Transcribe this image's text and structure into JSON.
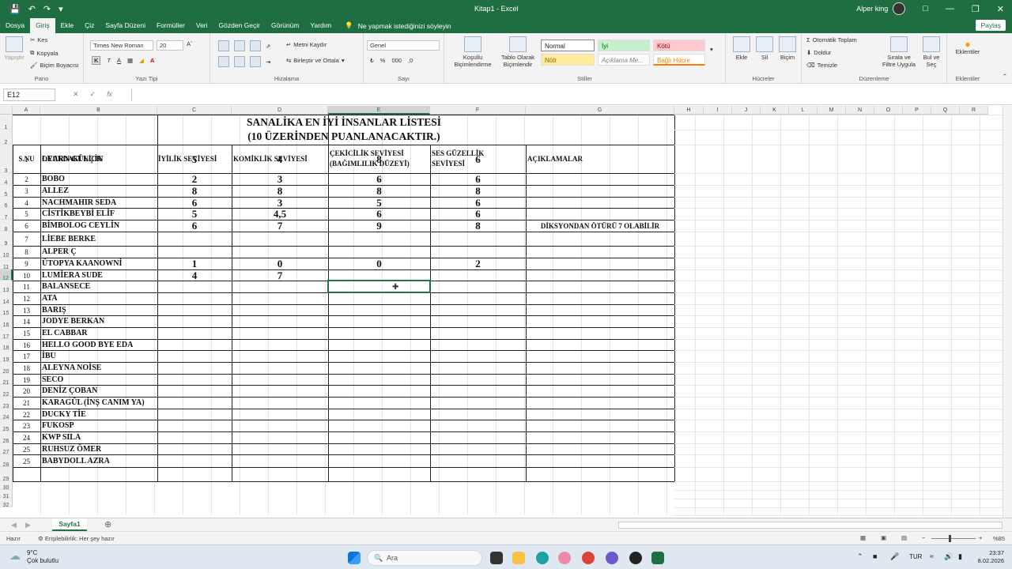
{
  "window": {
    "title": "Kitap1 - Excel",
    "user": "Alper king"
  },
  "tabs": [
    "Dosya",
    "Giriş",
    "Ekle",
    "Çiz",
    "Sayfa Düzeni",
    "Formüller",
    "Veri",
    "Gözden Geçir",
    "Görünüm",
    "Yardım"
  ],
  "active_tab": "Giriş",
  "tell_me": "Ne yapmak istediğinizi söyleyin",
  "share": "Paylaş",
  "ribbon": {
    "clipboard": {
      "paste": "Yapıştır",
      "cut": "Kes",
      "copy": "Kopyala",
      "format_painter": "Biçim Boyacısı",
      "label": "Pano"
    },
    "font": {
      "name": "Times New Roman",
      "size": "20",
      "label": "Yazı Tipi",
      "bold": "K",
      "italic": "T",
      "underline": "A"
    },
    "alignment": {
      "wrap": "Metni Kaydır",
      "merge": "Birleştir ve Ortala",
      "label": "Hizalama"
    },
    "number": {
      "format": "Genel",
      "label": "Sayı"
    },
    "styles": {
      "conditional": "Koşullu Biçimlendirme",
      "table": "Tablo Olarak Biçimlendir",
      "normal": "Normal",
      "good": "İyi",
      "bad": "Kötü",
      "neutral": "Nötr",
      "explanatory": "Açıklama Me...",
      "linked": "Bağlı Hücre",
      "label": "Stiller"
    },
    "cells": {
      "insert": "Ekle",
      "delete": "Sil",
      "format": "Biçim",
      "label": "Hücreler"
    },
    "editing": {
      "autosum": "Otomatik Toplam",
      "fill": "Doldur",
      "clear": "Temizle",
      "sort": "Sırala ve Filtre Uygula",
      "find": "Bul ve Seç",
      "label": "Düzenleme"
    },
    "addins": {
      "label": "Eklentiler",
      "name": "Eklentiler"
    }
  },
  "formula_bar": {
    "name_box": "E12",
    "formula": ""
  },
  "columns": [
    "A",
    "B",
    "C",
    "D",
    "E",
    "F",
    "G",
    "H",
    "I",
    "J",
    "K",
    "L",
    "M",
    "N",
    "O",
    "P",
    "Q",
    "R"
  ],
  "sheet": {
    "title_line1": "SANALİKA EN İYİ İNSANLAR LİSTESİ",
    "title_line2": "(10 ÜZERİNDEN PUANLANACAKTIR.)",
    "headers": [
      "S.NU",
      "OYUNDAKİ NİCK",
      "İYİLİK SEVİYESİ",
      "KOMİKLİK SEVİYESİ",
      "ÇEKİCİLİK SEVİYESİ (BAĞIMLILIK DÜZEYİ)",
      "SES GÜZELLİK SEVİYESİ",
      "AÇIKLAMALAR"
    ],
    "rows": [
      {
        "sn": "1",
        "nick": "LEARN GÜLÇİN",
        "iyilik": "5",
        "komiklik": "4",
        "cekicilik": "8",
        "ses": "6",
        "aciklama": ""
      },
      {
        "sn": "2",
        "nick": "BOBO",
        "iyilik": "2",
        "komiklik": "3",
        "cekicilik": "6",
        "ses": "6",
        "aciklama": ""
      },
      {
        "sn": "3",
        "nick": "ALLEZ",
        "iyilik": "8",
        "komiklik": "8",
        "cekicilik": "8",
        "ses": "8",
        "aciklama": ""
      },
      {
        "sn": "4",
        "nick": "NACHMAHIR SEDA",
        "iyilik": "6",
        "komiklik": "3",
        "cekicilik": "5",
        "ses": "6",
        "aciklama": ""
      },
      {
        "sn": "5",
        "nick": "CİSTİKBEYBİ ELİF",
        "iyilik": "5",
        "komiklik": "4,5",
        "cekicilik": "6",
        "ses": "6",
        "aciklama": ""
      },
      {
        "sn": "6",
        "nick": "BİMBOLOG CEYLİN",
        "iyilik": "6",
        "komiklik": "7",
        "cekicilik": "9",
        "ses": "8",
        "aciklama": "DİKSYONDAN ÖTÜRÜ 7 OLABİLİR"
      },
      {
        "sn": "7",
        "nick": "LİEBE BERKE",
        "iyilik": "",
        "komiklik": "",
        "cekicilik": "",
        "ses": "",
        "aciklama": ""
      },
      {
        "sn": "8",
        "nick": "ALPER Ç",
        "iyilik": "",
        "komiklik": "",
        "cekicilik": "",
        "ses": "",
        "aciklama": ""
      },
      {
        "sn": "9",
        "nick": "ÜTOPYA KAANOWNİ",
        "iyilik": "1",
        "komiklik": "0",
        "cekicilik": "0",
        "ses": "2",
        "aciklama": ""
      },
      {
        "sn": "10",
        "nick": "LUMİERA SUDE",
        "iyilik": "4",
        "komiklik": "7",
        "cekicilik": "",
        "ses": "",
        "aciklama": ""
      },
      {
        "sn": "11",
        "nick": "BALANSECE",
        "iyilik": "",
        "komiklik": "",
        "cekicilik": "",
        "ses": "",
        "aciklama": ""
      },
      {
        "sn": "12",
        "nick": "ATA",
        "iyilik": "",
        "komiklik": "",
        "cekicilik": "",
        "ses": "",
        "aciklama": ""
      },
      {
        "sn": "13",
        "nick": "BARIŞ",
        "iyilik": "",
        "komiklik": "",
        "cekicilik": "",
        "ses": "",
        "aciklama": ""
      },
      {
        "sn": "14",
        "nick": "JODYE BERKAN",
        "iyilik": "",
        "komiklik": "",
        "cekicilik": "",
        "ses": "",
        "aciklama": ""
      },
      {
        "sn": "15",
        "nick": "EL CABBAR",
        "iyilik": "",
        "komiklik": "",
        "cekicilik": "",
        "ses": "",
        "aciklama": ""
      },
      {
        "sn": "16",
        "nick": "HELLO GOOD BYE EDA",
        "iyilik": "",
        "komiklik": "",
        "cekicilik": "",
        "ses": "",
        "aciklama": ""
      },
      {
        "sn": "17",
        "nick": "İBU",
        "iyilik": "",
        "komiklik": "",
        "cekicilik": "",
        "ses": "",
        "aciklama": ""
      },
      {
        "sn": "18",
        "nick": "ALEYNA NOİSE",
        "iyilik": "",
        "komiklik": "",
        "cekicilik": "",
        "ses": "",
        "aciklama": ""
      },
      {
        "sn": "19",
        "nick": "SECO",
        "iyilik": "",
        "komiklik": "",
        "cekicilik": "",
        "ses": "",
        "aciklama": ""
      },
      {
        "sn": "20",
        "nick": "DENİZ ÇOBAN",
        "iyilik": "",
        "komiklik": "",
        "cekicilik": "",
        "ses": "",
        "aciklama": ""
      },
      {
        "sn": "21",
        "nick": "KARAGÜL (İNŞ CANIM YA)",
        "iyilik": "",
        "komiklik": "",
        "cekicilik": "",
        "ses": "",
        "aciklama": ""
      },
      {
        "sn": "22",
        "nick": "DUCKY TİE",
        "iyilik": "",
        "komiklik": "",
        "cekicilik": "",
        "ses": "",
        "aciklama": ""
      },
      {
        "sn": "23",
        "nick": "FUKOSP",
        "iyilik": "",
        "komiklik": "",
        "cekicilik": "",
        "ses": "",
        "aciklama": ""
      },
      {
        "sn": "24",
        "nick": "KWP SILA",
        "iyilik": "",
        "komiklik": "",
        "cekicilik": "",
        "ses": "",
        "aciklama": ""
      },
      {
        "sn": "25",
        "nick": "RUHSUZ ÖMER",
        "iyilik": "",
        "komiklik": "",
        "cekicilik": "",
        "ses": "",
        "aciklama": ""
      },
      {
        "sn": "25",
        "nick": "BABYDOLL AZRA",
        "iyilik": "",
        "komiklik": "",
        "cekicilik": "",
        "ses": "",
        "aciklama": ""
      }
    ],
    "row_numbers": [
      "1",
      "2",
      "3",
      "4",
      "5",
      "6",
      "7",
      "8",
      "9",
      "10",
      "11",
      "12",
      "13",
      "14",
      "15",
      "16",
      "17",
      "18",
      "19",
      "20",
      "21",
      "22",
      "23",
      "24",
      "25",
      "26",
      "27",
      "28",
      "29",
      "30",
      "31",
      "32"
    ]
  },
  "sheet_tab": "Sayfa1",
  "status": {
    "ready": "Hazır",
    "accessibility": "Erişilebilirlik: Her şey hazır",
    "zoom": "%85"
  },
  "taskbar": {
    "weather_temp": "9°C",
    "weather_desc": "Çok bulutlu",
    "search": "Ara",
    "lang": "TUR",
    "time": "23:37",
    "date": "8.02.2026"
  },
  "colors": {
    "excel_green": "#1e6e41",
    "selection": "#217346"
  }
}
